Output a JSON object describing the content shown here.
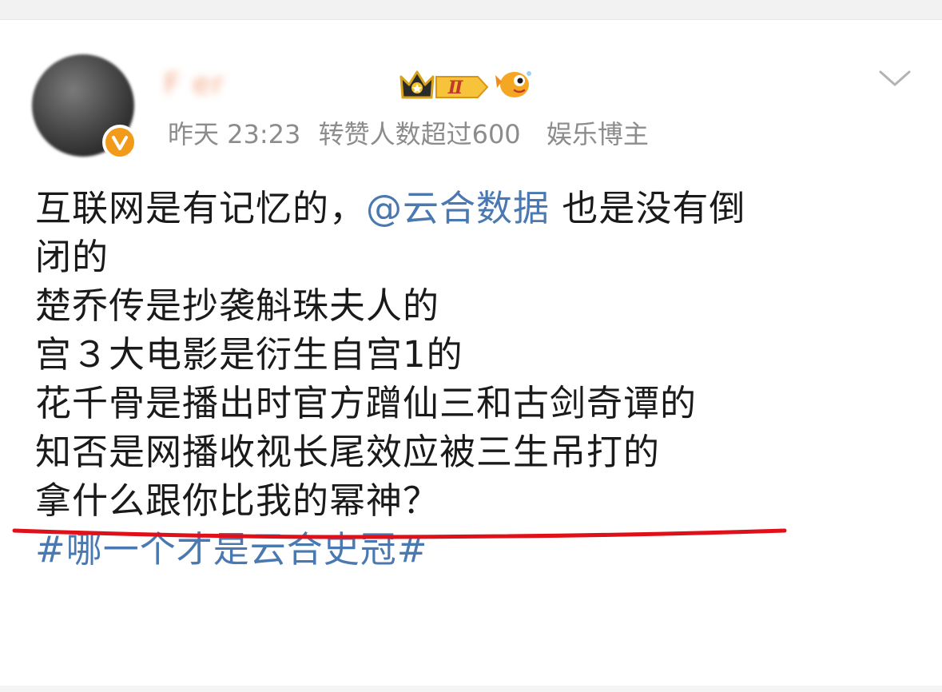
{
  "post": {
    "username": "F      er",
    "meta": {
      "time": "昨天 23:23",
      "repost_note": "转赞人数超过600",
      "category": "娱乐博主"
    },
    "content": {
      "line1_prefix": "互联网是有记忆的，",
      "mention": "@云合数据",
      "line1_suffix": " 也是没有倒",
      "line2": "闭的",
      "line3": "楚乔传是抄袭斛珠夫人的",
      "line4": "宫３大电影是衍生自宫1的",
      "line5": "花千骨是播出时官方蹭仙三和古剑奇谭的",
      "line6": "知否是网播收视长尾效应被三生吊打的",
      "line7": "拿什么跟你比我的幂神？",
      "hashtag": "#哪一个才是云合史冠#"
    },
    "badges": {
      "level": "Ⅱ"
    }
  },
  "icons": [
    "avatar",
    "verified-icon",
    "crown-badge-icon",
    "fish-badge-icon",
    "chevron-down-icon"
  ],
  "colors": {
    "link": "#4a78b0",
    "meta_text": "#8c8c8c",
    "verified": "#f29b1b",
    "underline": "#e0101a"
  }
}
